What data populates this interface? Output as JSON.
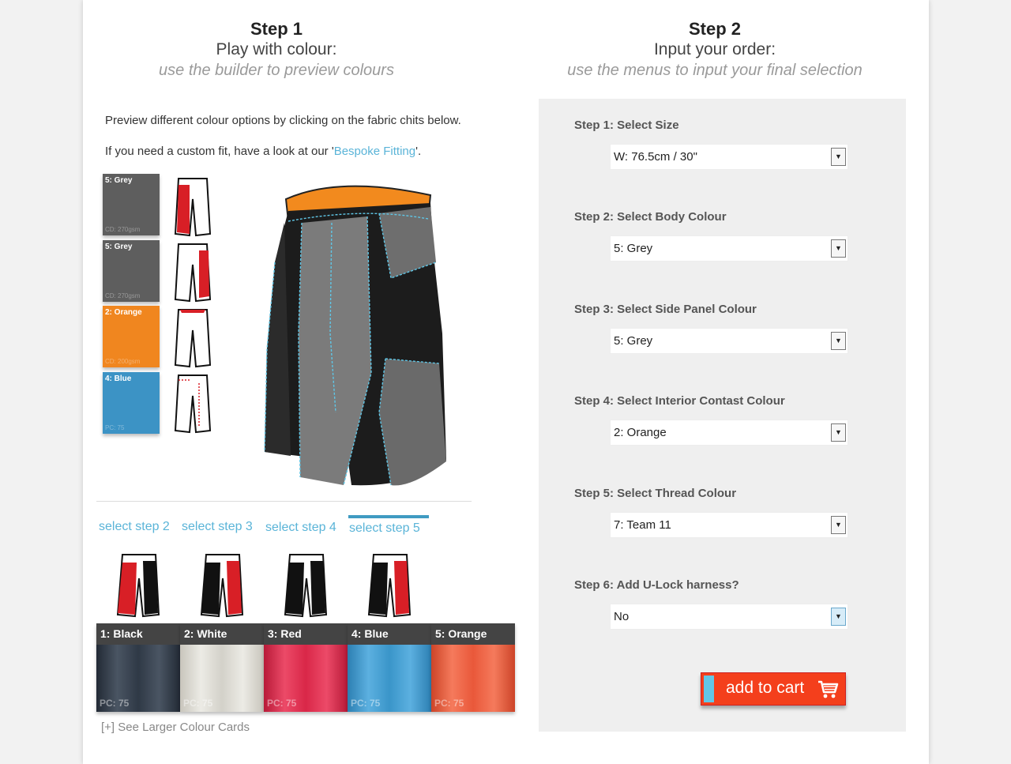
{
  "step1": {
    "title": "Step 1",
    "subtitle": "Play with colour:",
    "hint": "use the builder to preview colours",
    "intro": "Preview different colour options by clicking on the fabric chits below.",
    "custom_fit_prefix": "If you need a custom fit, have a look at our '",
    "custom_fit_link": "Bespoke Fitting",
    "custom_fit_suffix": "'.",
    "chits": [
      {
        "label": "5: Grey",
        "code": "CD: 270gsm",
        "color": "#5e5e5e"
      },
      {
        "label": "5: Grey",
        "code": "CD: 270gsm",
        "color": "#5e5e5e"
      },
      {
        "label": "2: Orange",
        "code": "CD: 200gsm",
        "color": "#f0861f"
      },
      {
        "label": "4: Blue",
        "code": "PC: 75",
        "color": "#3c93c5"
      }
    ],
    "step_tabs": [
      "select step 2",
      "select step 3",
      "select step 4",
      "select step 5"
    ],
    "active_tab": "select step 5",
    "threads": [
      {
        "name": "1: Black",
        "code": "PC: 75",
        "color": "#2f3946"
      },
      {
        "name": "2: White",
        "code": "PC: 75",
        "color": "#d8d6cf"
      },
      {
        "name": "3: Red",
        "code": "PC: 75",
        "color": "#d92748"
      },
      {
        "name": "4: Blue",
        "code": "PC: 75",
        "color": "#3a95c9"
      },
      {
        "name": "5: Orange",
        "code": "PC: 75",
        "color": "#e9583a"
      }
    ],
    "larger_cards": "[+] See Larger Colour Cards"
  },
  "step2": {
    "title": "Step 2",
    "subtitle": "Input your order:",
    "hint": "use the menus to input your final selection",
    "fields": [
      {
        "label": "Step 1: Select Size",
        "value": "W: 76.5cm / 30\""
      },
      {
        "label": "Step 2: Select Body Colour",
        "value": "5: Grey"
      },
      {
        "label": "Step 3: Select Side Panel Colour",
        "value": "5: Grey"
      },
      {
        "label": "Step 4: Select Interior Contast Colour",
        "value": "2: Orange"
      },
      {
        "label": "Step 5: Select Thread Colour",
        "value": "7: Team 11"
      },
      {
        "label": "Step 6: Add U-Lock harness?",
        "value": "No"
      }
    ],
    "add_to_cart": "add to cart"
  },
  "colors": {
    "accent": "#5ab4d8",
    "cart": "#f43f1c",
    "panel": "#efefef"
  }
}
